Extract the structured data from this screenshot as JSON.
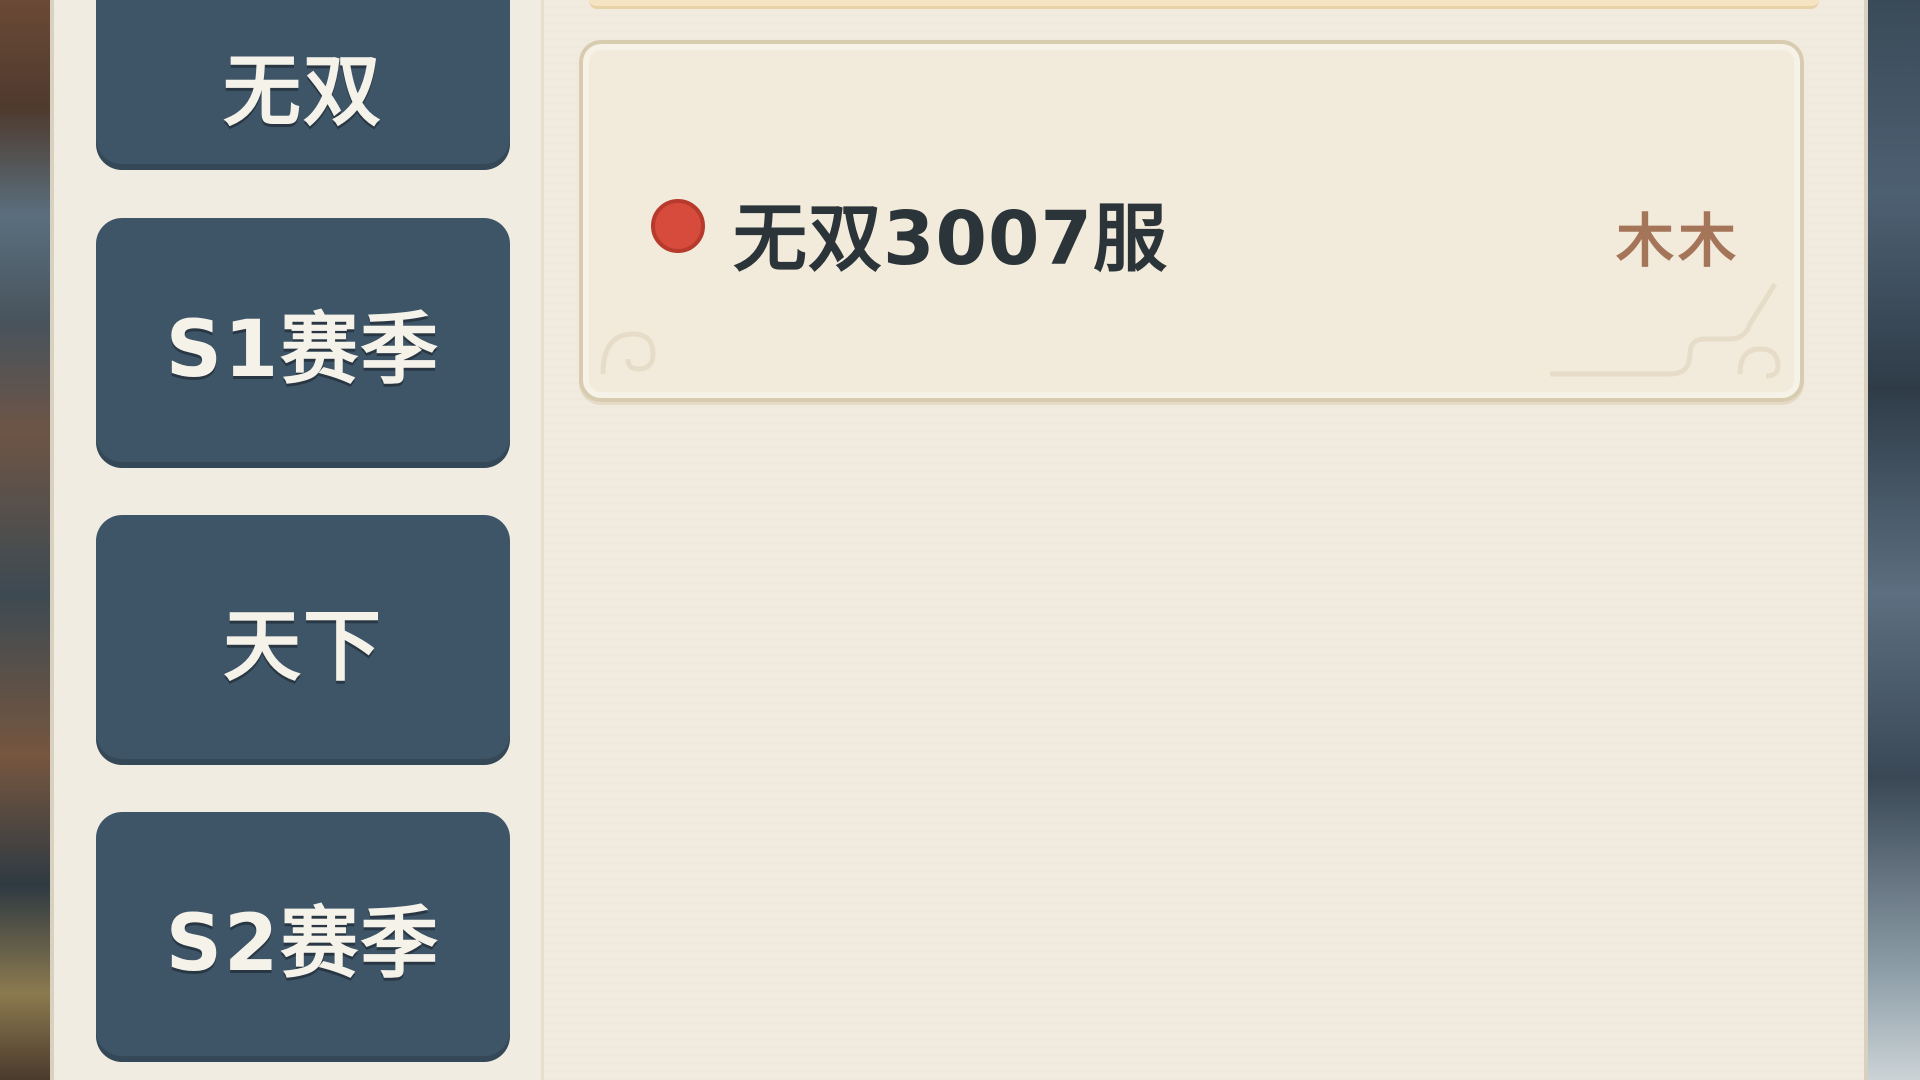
{
  "sidebar": {
    "tabs": [
      {
        "label": "无双"
      },
      {
        "label": "S1赛季"
      },
      {
        "label": "天下"
      },
      {
        "label": "S2赛季"
      }
    ]
  },
  "server_list": {
    "items": [
      {
        "name": "无双3007服",
        "tag": "木木",
        "status_color": "#d64b3c"
      }
    ]
  },
  "colors": {
    "tab_bg": "#3e5567",
    "parchment": "#f3eee3",
    "tag_text": "#a5755a"
  }
}
